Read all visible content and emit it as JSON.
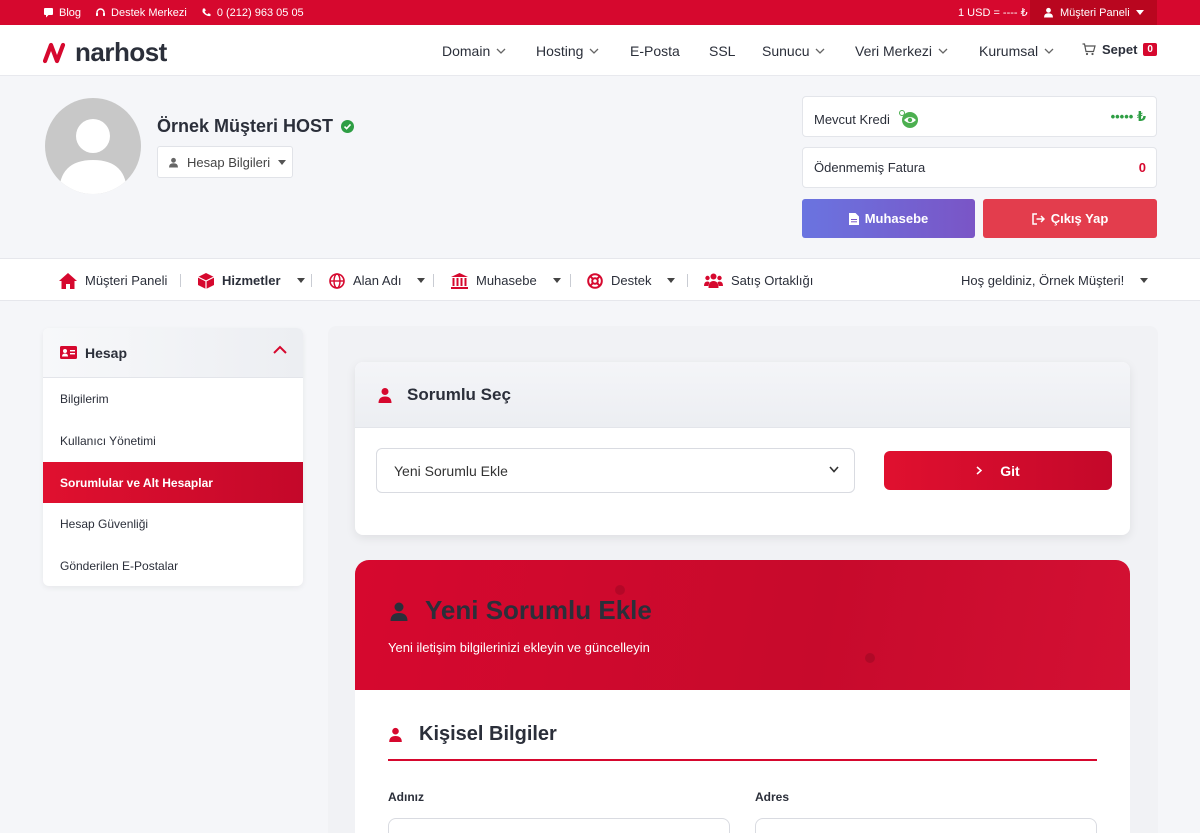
{
  "topbar": {
    "blog": "Blog",
    "support": "Destek Merkezi",
    "phone": "0 (212) 963 05 05",
    "currency": "1 USD = ---- ₺",
    "panel": "Müşteri Paneli"
  },
  "header": {
    "logo": "narhost",
    "nav": [
      "Domain",
      "Hosting",
      "E-Posta",
      "SSL",
      "Sunucu",
      "Veri Merkezi",
      "Kurumsal"
    ],
    "cart_label": "Sepet",
    "cart_count": "0"
  },
  "profile": {
    "name": "Örnek Müşteri HOST",
    "account_button": "Hesap Bilgileri",
    "credit_label": "Mevcut Kredi",
    "credit_value": "••••• ₺",
    "unpaid_label": "Ödenmemiş Fatura",
    "unpaid_value": "0",
    "accounting_button": "Muhasebe",
    "logout_button": "Çıkış Yap"
  },
  "subnav": {
    "items": [
      "Müşteri Paneli",
      "Hizmetler",
      "Alan Adı",
      "Muhasebe",
      "Destek",
      "Satış Ortaklığı"
    ],
    "welcome": "Hoş geldiniz, Örnek Müşteri!"
  },
  "sidebar": {
    "title": "Hesap",
    "items": [
      "Bilgilerim",
      "Kullanıcı Yönetimi",
      "Sorumlular ve Alt Hesaplar",
      "Hesap Güvenliği",
      "Gönderilen E-Postalar"
    ]
  },
  "select_card": {
    "title": "Sorumlu Seç",
    "selected": "Yeni Sorumlu Ekle",
    "go_button": "Git"
  },
  "hero": {
    "title": "Yeni Sorumlu Ekle",
    "subtitle": "Yeni iletişim bilgilerinizi ekleyin ve güncelleyin"
  },
  "form": {
    "section_title": "Kişisel Bilgiler",
    "first_name_label": "Adınız",
    "address_label": "Adres"
  },
  "colors": {
    "brand_red": "#d6082e",
    "accounting_purple": "#6a74e0",
    "logout_red": "#e33d4d",
    "credit_green": "#2e9e44"
  }
}
